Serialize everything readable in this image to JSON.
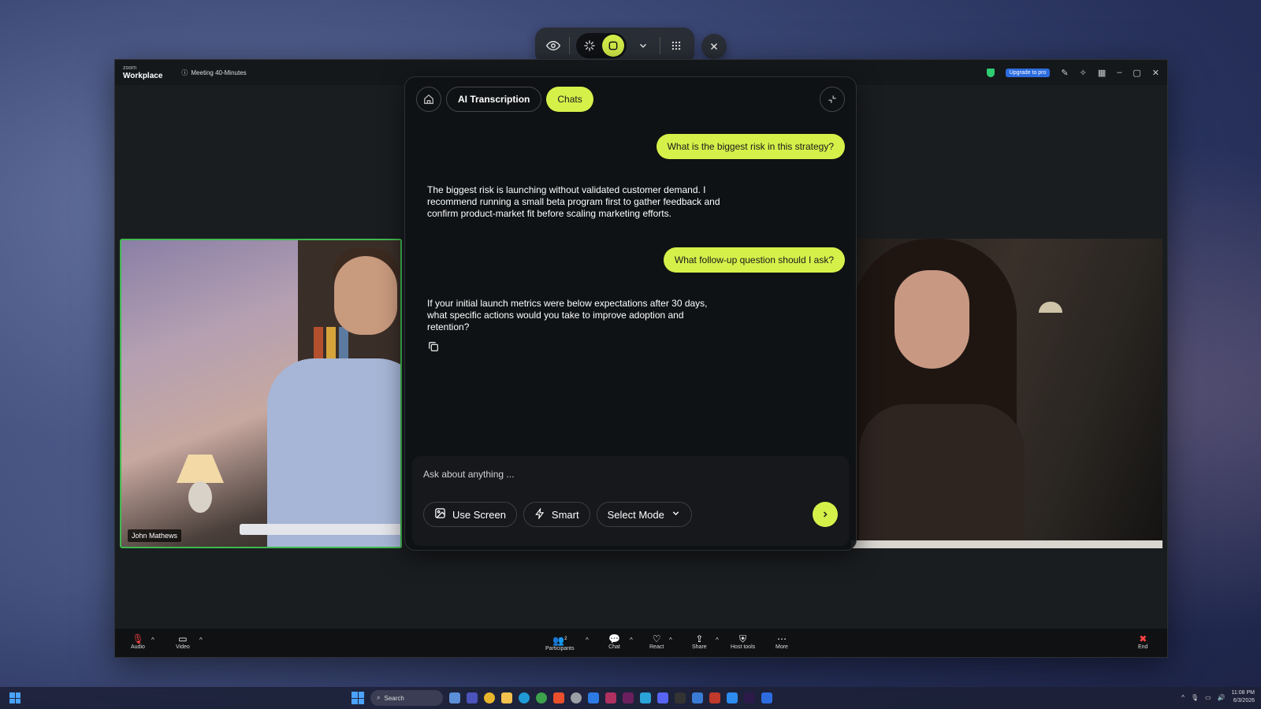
{
  "floating_toolbar": {
    "icons": [
      "eye-icon",
      "sparkle-icon",
      "stop-icon",
      "chevron-down-icon",
      "grid-icon",
      "close-icon"
    ]
  },
  "window": {
    "logo_top": "zoom",
    "logo_bottom": "Workplace",
    "meeting_info": "Meeting 40-Minutes",
    "upgrade_label": "Upgrade to pro"
  },
  "participants": {
    "left_name": "John Mathews"
  },
  "ai_panel": {
    "tabs": [
      {
        "label": "AI Transcription",
        "active": false
      },
      {
        "label": "Chats",
        "active": true
      }
    ],
    "messages": [
      {
        "role": "user",
        "text": "What is the biggest risk in this strategy?"
      },
      {
        "role": "assistant",
        "text": "The biggest risk is launching without validated customer demand. I recommend running a small beta program first to gather feedback and confirm product-market fit before scaling marketing efforts."
      },
      {
        "role": "user",
        "text": "What follow-up question should I ask?"
      },
      {
        "role": "assistant",
        "text": "If your initial launch metrics were below expectations after 30 days, what specific actions would you take to improve adoption and retention?"
      }
    ],
    "input_placeholder": "Ask about anything ...",
    "use_screen_label": "Use Screen",
    "smart_label": "Smart",
    "select_mode_label": "Select Mode"
  },
  "bottom_bar": {
    "audio": "Audio",
    "video": "Video",
    "participants": "Participants",
    "participants_count": "2",
    "chat": "Chat",
    "react": "React",
    "share": "Share",
    "host_tools": "Host tools",
    "more": "More",
    "end": "End"
  },
  "taskbar": {
    "search": "Search",
    "time": "11:08 PM",
    "date": "6/3/2026"
  },
  "colors": {
    "accent": "#d6f04a",
    "active_speaker": "#3fb950",
    "upgrade": "#2d6cdf"
  }
}
